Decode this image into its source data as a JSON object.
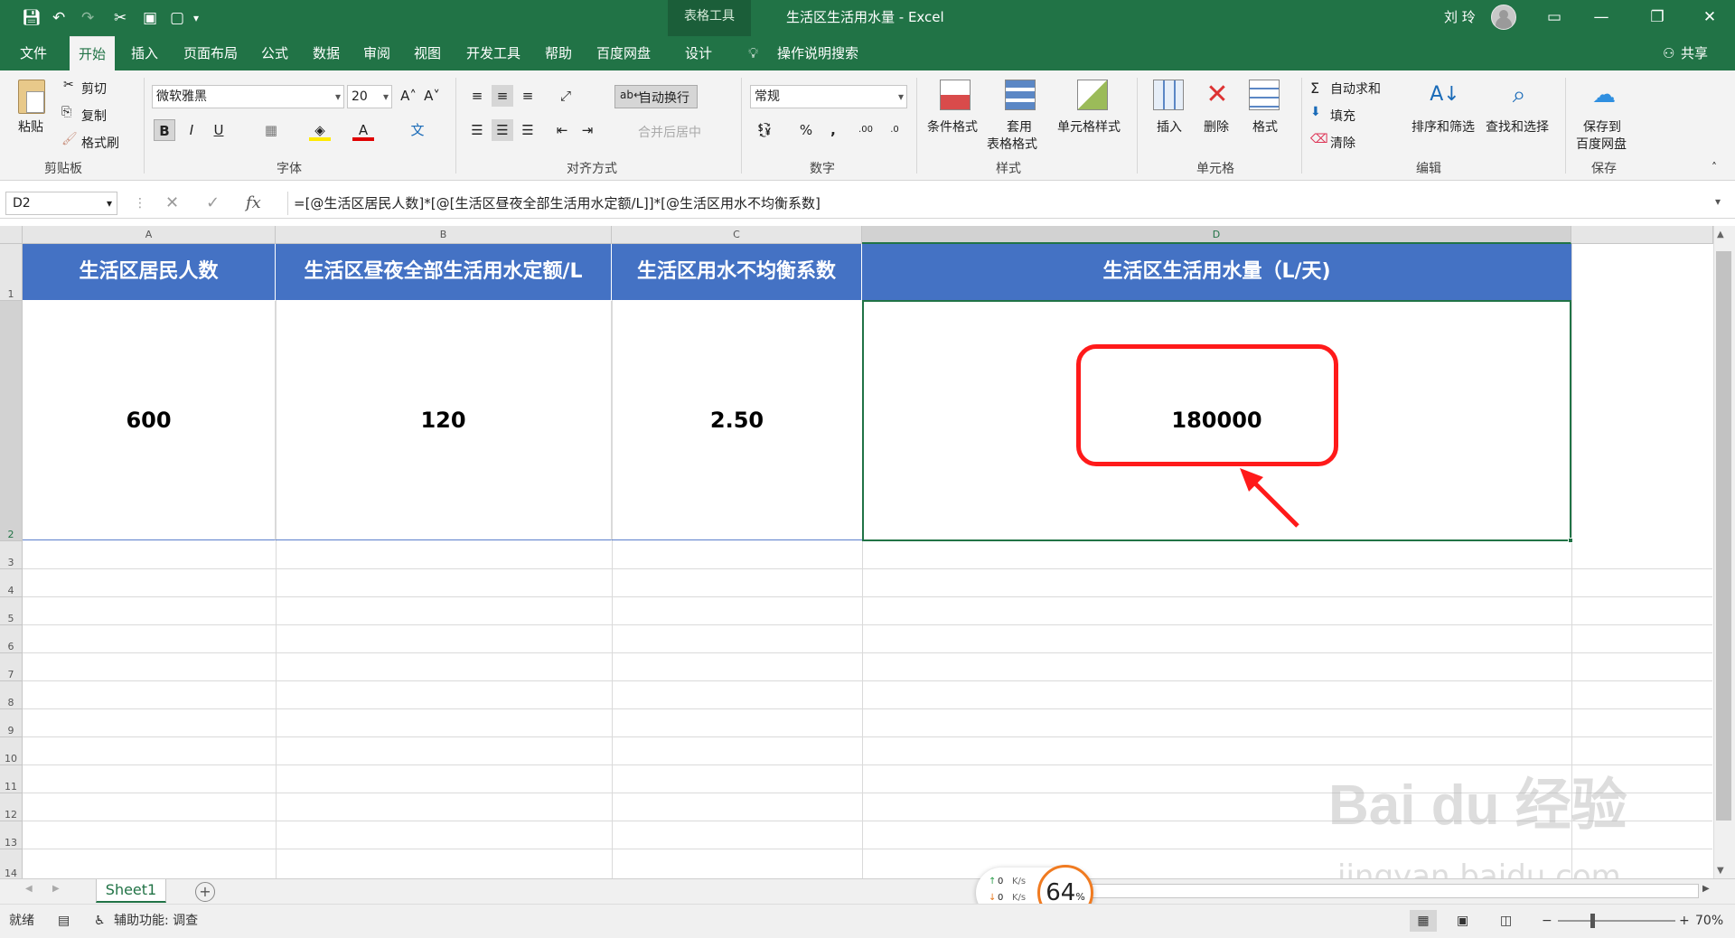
{
  "window": {
    "title": "生活区生活用水量 - Excel",
    "context_tab_group": "表格工具",
    "user": "刘 玲"
  },
  "tabs": [
    {
      "label": "文件"
    },
    {
      "label": "开始"
    },
    {
      "label": "插入"
    },
    {
      "label": "页面布局"
    },
    {
      "label": "公式"
    },
    {
      "label": "数据"
    },
    {
      "label": "审阅"
    },
    {
      "label": "视图"
    },
    {
      "label": "开发工具"
    },
    {
      "label": "帮助"
    },
    {
      "label": "百度网盘"
    },
    {
      "label": "设计"
    }
  ],
  "tell_me": "操作说明搜索",
  "share": "共享",
  "ribbon": {
    "clipboard": {
      "paste": "粘贴",
      "cut": "剪切",
      "copy": "复制",
      "format_painter": "格式刷",
      "label": "剪贴板"
    },
    "font": {
      "name": "微软雅黑",
      "size": "20",
      "label": "字体",
      "bold": "B",
      "italic": "I",
      "underline": "U"
    },
    "alignment": {
      "wrap": "自动换行",
      "merge": "合并后居中",
      "label": "对齐方式"
    },
    "number": {
      "format": "常规",
      "label": "数字",
      "percent": "%",
      "comma": ","
    },
    "styles": {
      "conditional": "条件格式",
      "table_line1": "套用",
      "table_line2": "表格格式",
      "cell_styles": "单元格样式",
      "label": "样式"
    },
    "cells": {
      "insert": "插入",
      "delete": "删除",
      "format": "格式",
      "label": "单元格"
    },
    "editing": {
      "autosum": "自动求和",
      "fill": "填充",
      "clear": "清除",
      "sort": "排序和筛选",
      "find": "查找和选择",
      "label": "编辑"
    },
    "save": {
      "line1": "保存到",
      "line2": "百度网盘",
      "label": "保存"
    }
  },
  "formula_bar": {
    "name_box": "D2",
    "formula": "=[@生活区居民人数]*[@[生活区昼夜全部生活用水定额/L]]*[@生活区用水不均衡系数]"
  },
  "columns": [
    "A",
    "B",
    "C",
    "D"
  ],
  "rows": [
    "1",
    "2",
    "3",
    "4",
    "5",
    "6",
    "7",
    "8",
    "9",
    "10",
    "11",
    "12",
    "13",
    "14"
  ],
  "table": {
    "headers": [
      "生活区居民人数",
      "生活区昼夜全部生活用水定额/L",
      "生活区用水不均衡系数",
      "生活区生活用水量（L/天)"
    ],
    "values": [
      "600",
      "120",
      "2.50",
      "180000"
    ]
  },
  "sheet_tab": "Sheet1",
  "status": {
    "ready": "就绪",
    "accessibility": "辅助功能: 调查",
    "zoom": "70%"
  },
  "net_widget": {
    "up": "0",
    "down": "0",
    "unit": "K/s",
    "value": "64",
    "suffix": "%"
  },
  "watermark": {
    "main": "Bai du 经验",
    "sub": "jingyan.baidu.com"
  },
  "colors": {
    "excel_green": "#217346",
    "header_blue": "#4472c4",
    "highlight_red": "#ff1a1a"
  }
}
